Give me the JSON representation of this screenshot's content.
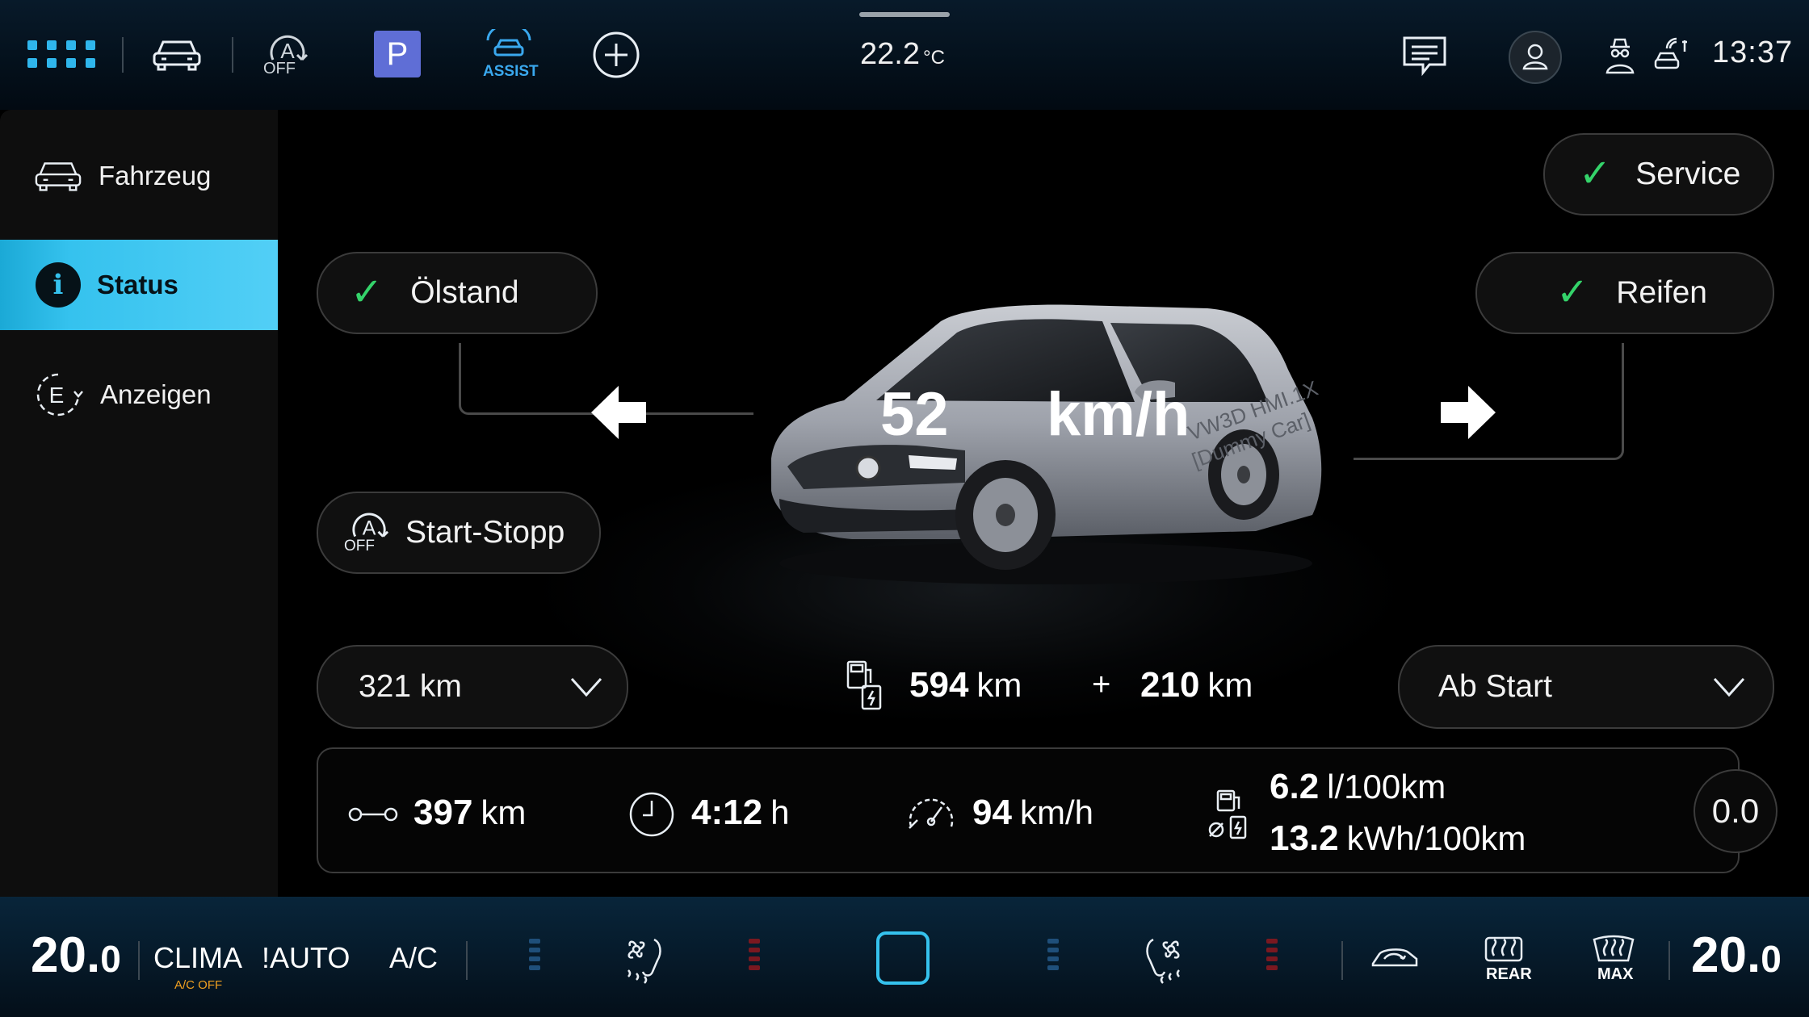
{
  "topbar": {
    "assist_label": "ASSIST",
    "off_label": "OFF",
    "parking_label": "P",
    "temperature": "22.2",
    "temperature_unit": "°C",
    "time": "13:37"
  },
  "sidebar": {
    "items": [
      {
        "label": "Fahrzeug",
        "icon": "car-outline-icon",
        "active": false
      },
      {
        "label": "Status",
        "icon": "info-icon",
        "active": true
      },
      {
        "label": "Anzeigen",
        "icon": "display-e-icon",
        "active": false
      }
    ]
  },
  "main": {
    "service_label": "Service",
    "oil_label": "Ölstand",
    "tires_label": "Reifen",
    "start_stop_label": "Start-Stopp",
    "speed_value": "52",
    "speed_unit": "km/h",
    "car_decal_1": "VW3D HMI.1X",
    "car_decal_2": "[Dummy Car]",
    "range_select": {
      "value": "321 km"
    },
    "range_fuel": {
      "value": "594",
      "unit": "km"
    },
    "range_plus": "+",
    "range_electric": {
      "value": "210",
      "unit": "km"
    },
    "period_select": {
      "value": "Ab Start"
    },
    "stats": {
      "distance": {
        "value": "397",
        "unit": "km"
      },
      "time": {
        "value": "4:12",
        "unit": "h"
      },
      "avg_speed": {
        "value": "94",
        "unit": "km/h"
      },
      "consumption_fuel": {
        "value": "6.2",
        "unit": "l/100km"
      },
      "consumption_electric": {
        "value": "13.2",
        "unit": "kWh/100km"
      },
      "reset_label": "0.0"
    }
  },
  "climate": {
    "left_temp_int": "20.",
    "left_temp_dec": "0",
    "clima_label": "CLIMA",
    "ac_off_label": "A/C OFF",
    "auto_label": "!AUTO",
    "ac_label": "A/C",
    "rear_label": "REAR",
    "max_label": "MAX",
    "right_temp_int": "20.",
    "right_temp_dec": "0"
  },
  "colors": {
    "accent": "#35c2ee",
    "check_green": "#34d36a",
    "ac_off_orange": "#f0a020",
    "heat_red": "#7a1820",
    "cool_blue": "#1f4f7a"
  }
}
